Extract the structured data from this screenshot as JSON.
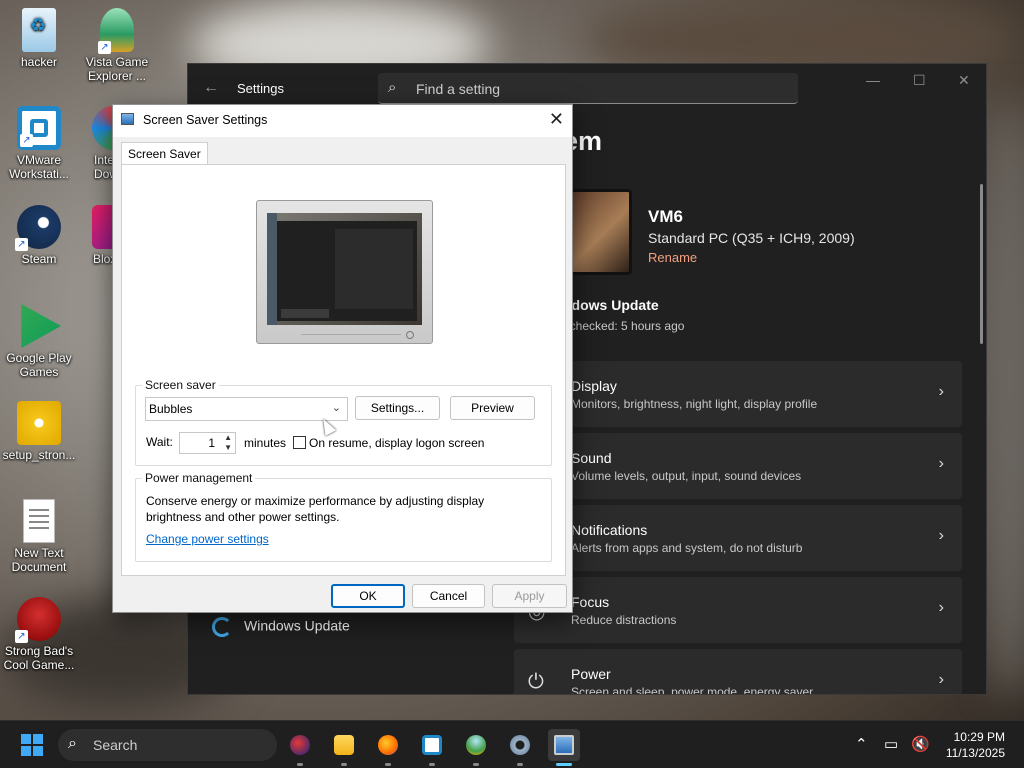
{
  "desktop": {
    "icons": [
      {
        "label": "hacker"
      },
      {
        "label": "Vista Game Explorer ..."
      },
      {
        "label": "VMware Workstati..."
      },
      {
        "label": "Inte Dow"
      },
      {
        "label": "Steam"
      },
      {
        "label": "Blox"
      },
      {
        "label": "Google Play Games"
      },
      {
        "label": "setup_stron..."
      },
      {
        "label": "New Text Document"
      },
      {
        "label": "Strong Bad's Cool Game..."
      }
    ]
  },
  "settings": {
    "app_title": "Settings",
    "search_placeholder": "Find a setting",
    "page_title": "em",
    "device": {
      "name": "VM6",
      "model": "Standard PC (Q35 + ICH9, 2009)",
      "rename": "Rename"
    },
    "windows_update": {
      "title": "ndows Update",
      "subtitle": "t checked: 5 hours ago"
    },
    "rows": [
      {
        "title": "Display",
        "subtitle": "Monitors, brightness, night light, display profile"
      },
      {
        "title": "Sound",
        "subtitle": "Volume levels, output, input, sound devices"
      },
      {
        "title": "Notifications",
        "subtitle": "Alerts from apps and system, do not disturb"
      },
      {
        "title": "Focus",
        "subtitle": "Reduce distractions"
      },
      {
        "title": "Power",
        "subtitle": "Screen and sleep, power mode, energy saver"
      }
    ],
    "nav_windows_update": "Windows Update"
  },
  "dialog": {
    "title": "Screen Saver Settings",
    "tab": "Screen Saver",
    "screen_saver_group": "Screen saver",
    "selected_saver": "Bubbles",
    "settings_button": "Settings...",
    "preview_button": "Preview",
    "wait_label": "Wait:",
    "wait_value": "1",
    "minutes_label": "minutes",
    "resume_checkbox_label": "On resume, display logon screen",
    "resume_checked": false,
    "power_group": "Power management",
    "power_text": "Conserve energy or maximize performance by adjusting display brightness and other power settings.",
    "power_link": "Change power settings",
    "ok": "OK",
    "cancel": "Cancel",
    "apply": "Apply"
  },
  "taskbar": {
    "search_label": "Search",
    "time": "10:29 PM",
    "date": "11/13/2025",
    "apps": [
      "globe-app",
      "file-explorer",
      "firefox",
      "vmware",
      "game-explorer",
      "settings",
      "screen-saver-settings"
    ]
  },
  "colors": {
    "accent": "#0067c0",
    "link": "#0066cc",
    "rename": "#f2a07f",
    "start": "#3fa9f5"
  }
}
